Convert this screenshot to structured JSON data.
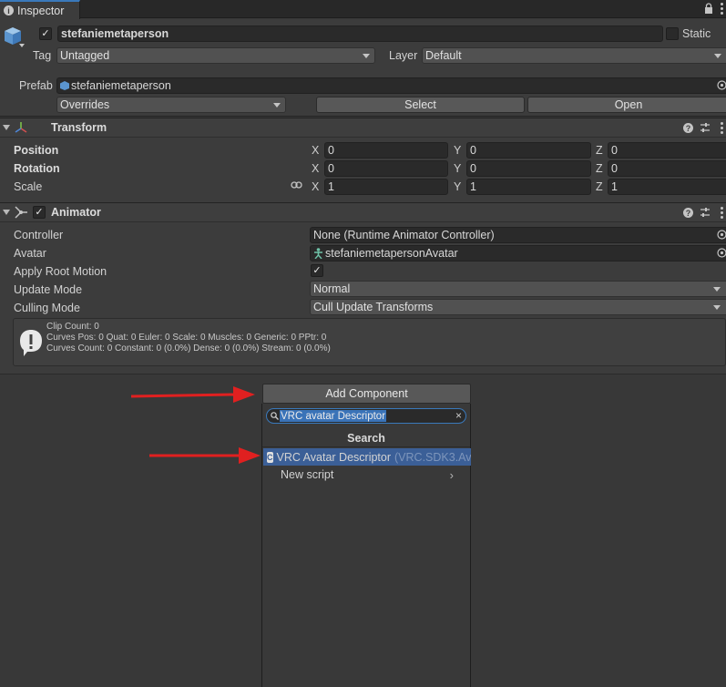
{
  "tab": {
    "title": "Inspector",
    "icon": "info-icon"
  },
  "header": {
    "object_name": "stefaniemetaperson",
    "active_checked": "✓",
    "static_label": "Static",
    "tag_label": "Tag",
    "tag_value": "Untagged",
    "layer_label": "Layer",
    "layer_value": "Default",
    "prefab_label": "Prefab",
    "prefab_value": "stefaniemetaperson",
    "overrides_value": "Overrides",
    "select_label": "Select",
    "open_label": "Open"
  },
  "transform": {
    "title": "Transform",
    "rows": [
      {
        "label": "Position",
        "x": "0",
        "y": "0",
        "z": "0"
      },
      {
        "label": "Rotation",
        "x": "0",
        "y": "0",
        "z": "0"
      },
      {
        "label": "Scale",
        "x": "1",
        "y": "1",
        "z": "1"
      }
    ],
    "axis": {
      "x": "X",
      "y": "Y",
      "z": "Z"
    }
  },
  "animator": {
    "title": "Animator",
    "enabled_checked": "✓",
    "controller_label": "Controller",
    "controller_value": "None (Runtime Animator Controller)",
    "avatar_label": "Avatar",
    "avatar_value": "stefaniemetapersonAvatar",
    "apply_root_motion_label": "Apply Root Motion",
    "apply_root_motion_checked": "✓",
    "update_mode_label": "Update Mode",
    "update_mode_value": "Normal",
    "culling_mode_label": "Culling Mode",
    "culling_mode_value": "Cull Update Transforms",
    "info": [
      "Clip Count: 0",
      "Curves Pos: 0 Quat: 0 Euler: 0 Scale: 0 Muscles: 0 Generic: 0 PPtr: 0",
      "Curves Count: 0 Constant: 0 (0.0%) Dense: 0 (0.0%) Stream: 0 (0.0%)"
    ]
  },
  "add_component": {
    "button_label": "Add Component",
    "search_value": "VRC avatar Descriptor",
    "clear_glyph": "×",
    "popup_title": "Search",
    "result_name": "VRC Avatar Descriptor",
    "result_namespace": "(VRC.SDK3.Av",
    "new_script_label": "New script",
    "chevron": "›"
  },
  "colors": {
    "background": "#383838",
    "selection": "#3b5f97",
    "accent": "#3a79bb",
    "annotation_arrow": "#e02020"
  }
}
